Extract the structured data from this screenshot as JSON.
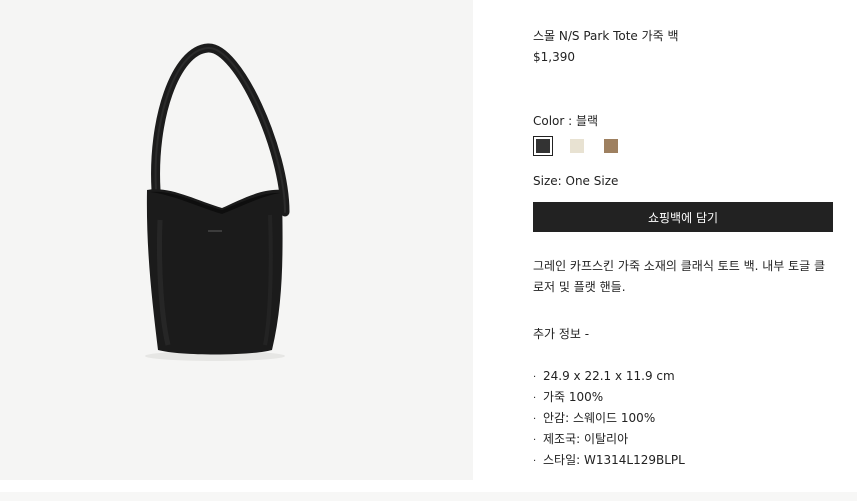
{
  "product": {
    "title": "스몰 N/S Park Tote 가죽 백",
    "price": "$1,390",
    "color_label": "Color : ",
    "color_value": "블랙",
    "swatches": [
      {
        "name": "black",
        "color": "#333333",
        "selected": true
      },
      {
        "name": "ivory",
        "color": "#e8e2d2",
        "selected": false
      },
      {
        "name": "taupe",
        "color": "#9e8060",
        "selected": false
      }
    ],
    "size_label": "Size: ",
    "size_value": "One Size",
    "cart_button": "쇼핑백에 담기",
    "description": "그레인 카프스킨 가죽 소재의 클래식 토트 백. 내부 토글 클로저 및 플랫 핸들.",
    "more_info_label": "추가 정보  -",
    "specs": [
      "24.9 x 22.1 x 11.9 cm",
      "가죽 100%",
      "안감: 스웨이드 100%",
      "제조국: 이탈리아",
      "스타일: W1314L129BLPL"
    ]
  }
}
